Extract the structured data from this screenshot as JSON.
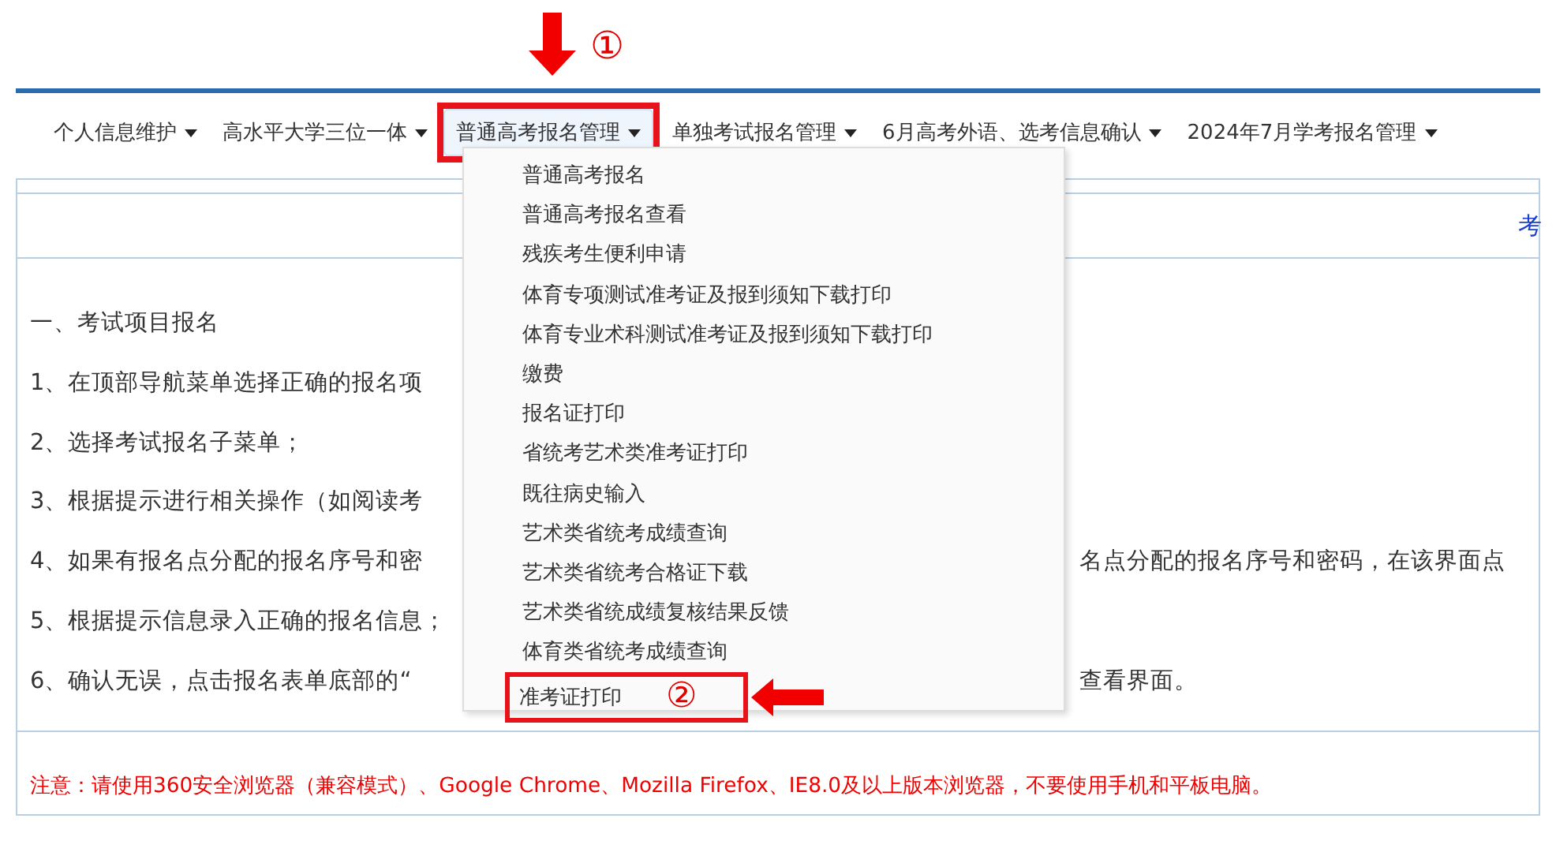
{
  "annotations": {
    "nav_marker": "①",
    "menu_marker": "②"
  },
  "nav": [
    {
      "label": "个人信息维护",
      "selected": false
    },
    {
      "label": "高水平大学三位一体",
      "selected": false
    },
    {
      "label": "普通高考报名管理",
      "selected": true
    },
    {
      "label": "单独考试报名管理",
      "selected": false
    },
    {
      "label": "6月高考外语、选考信息确认",
      "selected": false
    },
    {
      "label": "2024年7月学考报名管理",
      "selected": false
    }
  ],
  "dropdown": {
    "items": [
      {
        "label": "普通高考报名",
        "highlighted": false
      },
      {
        "label": "普通高考报名查看",
        "highlighted": false
      },
      {
        "label": "残疾考生便利申请",
        "highlighted": false
      },
      {
        "label": "体育专项测试准考证及报到须知下载打印",
        "highlighted": false
      },
      {
        "label": "体育专业术科测试准考证及报到须知下载打印",
        "highlighted": false
      },
      {
        "label": "缴费",
        "highlighted": false
      },
      {
        "label": "报名证打印",
        "highlighted": false
      },
      {
        "label": "省统考艺术类准考证打印",
        "highlighted": false
      },
      {
        "label": "既往病史输入",
        "highlighted": false
      },
      {
        "label": "艺术类省统考成绩查询",
        "highlighted": false
      },
      {
        "label": "艺术类省统考合格证下载",
        "highlighted": false
      },
      {
        "label": "艺术类省统成绩复核结果反馈",
        "highlighted": false
      },
      {
        "label": "体育类省统考成绩查询",
        "highlighted": false
      },
      {
        "label": "准考证打印",
        "highlighted": true
      }
    ]
  },
  "content": {
    "top_link": "考",
    "lines": [
      {
        "left": "一、考试项目报名"
      },
      {
        "left": "1、在顶部导航菜单选择正确的报名项"
      },
      {
        "left": "2、选择考试报名子菜单；"
      },
      {
        "left": "3、根据提示进行相关操作（如阅读考"
      },
      {
        "left": "4、如果有报名点分配的报名序号和密",
        "right": "名点分配的报名序号和密码，在该界面点"
      },
      {
        "left": "5、根据提示信息录入正确的报名信息；"
      },
      {
        "left": "6、确认无误，点击报名表单底部的“",
        "right": "查看界面。"
      }
    ],
    "notice": "注意：请使用360安全浏览器（兼容模式）、Google Chrome、Mozilla Firefox、IE8.0及以上版本浏览器，不要使用手机和平板电脑。"
  }
}
